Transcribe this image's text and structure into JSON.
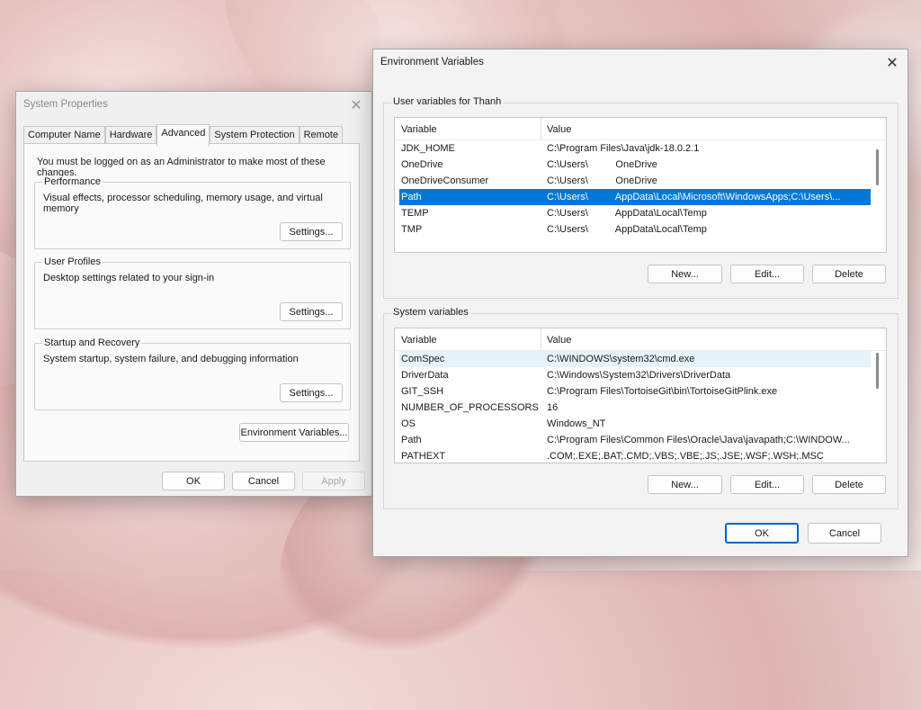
{
  "system_properties": {
    "title": "System Properties",
    "tabs": [
      "Computer Name",
      "Hardware",
      "Advanced",
      "System Protection",
      "Remote"
    ],
    "active_tab": "Advanced",
    "admin_note": "You must be logged on as an Administrator to make most of these changes.",
    "performance": {
      "title": "Performance",
      "description": "Visual effects, processor scheduling, memory usage, and virtual memory",
      "button": "Settings..."
    },
    "user_profiles": {
      "title": "User Profiles",
      "description": "Desktop settings related to your sign-in",
      "button": "Settings..."
    },
    "startup_recovery": {
      "title": "Startup and Recovery",
      "description": "System startup, system failure, and debugging information",
      "button": "Settings..."
    },
    "env_vars_button": "Environment Variables...",
    "ok_label": "OK",
    "cancel_label": "Cancel",
    "apply_label": "Apply"
  },
  "environment_variables": {
    "title": "Environment Variables",
    "user_section_title": "User variables for Thanh",
    "system_section_title": "System variables",
    "columns": {
      "variable": "Variable",
      "value": "Value"
    },
    "user_vars": [
      {
        "name": "JDK_HOME",
        "value": "C:\\Program Files\\Java\\jdk-18.0.2.1"
      },
      {
        "name": "OneDrive",
        "value": "C:\\Users\\          OneDrive"
      },
      {
        "name": "OneDriveConsumer",
        "value": "C:\\Users\\          OneDrive"
      },
      {
        "name": "Path",
        "value": "C:\\Users\\          AppData\\Local\\Microsoft\\WindowsApps;C:\\Users\\..."
      },
      {
        "name": "TEMP",
        "value": "C:\\Users\\          AppData\\Local\\Temp"
      },
      {
        "name": "TMP",
        "value": "C:\\Users\\          AppData\\Local\\Temp"
      }
    ],
    "system_vars": [
      {
        "name": "ComSpec",
        "value": "C:\\WINDOWS\\system32\\cmd.exe"
      },
      {
        "name": "DriverData",
        "value": "C:\\Windows\\System32\\Drivers\\DriverData"
      },
      {
        "name": "GIT_SSH",
        "value": "C:\\Program Files\\TortoiseGit\\bin\\TortoiseGitPlink.exe"
      },
      {
        "name": "NUMBER_OF_PROCESSORS",
        "value": "16"
      },
      {
        "name": "OS",
        "value": "Windows_NT"
      },
      {
        "name": "Path",
        "value": "C:\\Program Files\\Common Files\\Oracle\\Java\\javapath;C:\\WINDOW..."
      },
      {
        "name": "PATHEXT",
        "value": ".COM;.EXE;.BAT;.CMD;.VBS;.VBE;.JS;.JSE;.WSF;.WSH;.MSC"
      }
    ],
    "selected_user_var": "Path",
    "hovered_system_var": "ComSpec",
    "new_label": "New...",
    "edit_label": "Edit...",
    "delete_label": "Delete",
    "ok_label": "OK",
    "cancel_label": "Cancel"
  },
  "colors": {
    "selection": "#0078d7",
    "hover": "#e5f3fb",
    "accent_border": "#0067c0"
  }
}
